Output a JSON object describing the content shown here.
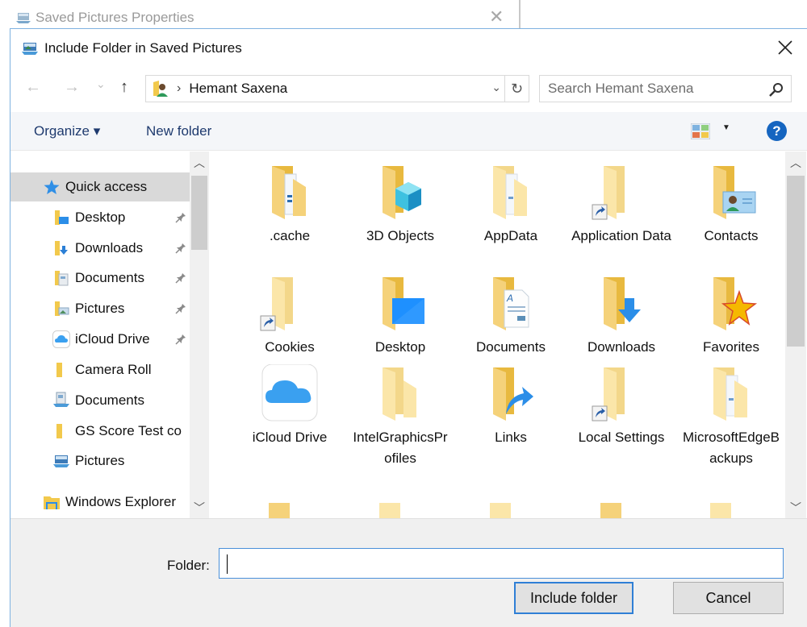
{
  "background_window": {
    "title": "Saved Pictures Properties",
    "icon": "library-pictures-icon",
    "close_glyph": "✕"
  },
  "dialog": {
    "title": "Include Folder in Saved Pictures",
    "icon": "library-pictures-icon",
    "close_glyph": "close-icon"
  },
  "navigation": {
    "back": "←",
    "forward": "→",
    "recent_dropdown": "⌄",
    "up": "↑",
    "address_icon": "user-folder-icon",
    "breadcrumb_separator": "›",
    "breadcrumb": "Hemant Saxena",
    "address_dropdown": "⌄",
    "refresh": "↻",
    "search_placeholder": "Search Hemant Saxena"
  },
  "toolbar": {
    "organize": "Organize ▾",
    "new_folder": "New folder",
    "view_icon": "change-view-icon",
    "view_dropdown": "▼",
    "help": "?"
  },
  "sidebar": {
    "items": [
      {
        "label": "Quick access",
        "icon": "star",
        "pinned": false,
        "selected": true,
        "level": 0
      },
      {
        "label": "Desktop",
        "icon": "desktop-folder",
        "pinned": true,
        "selected": false,
        "level": 1
      },
      {
        "label": "Downloads",
        "icon": "downloads-folder",
        "pinned": true,
        "selected": false,
        "level": 1
      },
      {
        "label": "Documents",
        "icon": "documents-folder",
        "pinned": true,
        "selected": false,
        "level": 1
      },
      {
        "label": "Pictures",
        "icon": "pictures-folder",
        "pinned": true,
        "selected": false,
        "level": 1
      },
      {
        "label": "iCloud Drive",
        "icon": "icloud",
        "pinned": true,
        "selected": false,
        "level": 1
      },
      {
        "label": "Camera Roll",
        "icon": "folder",
        "pinned": false,
        "selected": false,
        "level": 1
      },
      {
        "label": "Documents",
        "icon": "documents-library",
        "pinned": false,
        "selected": false,
        "level": 1
      },
      {
        "label": "GS Score Test co",
        "icon": "folder",
        "pinned": false,
        "selected": false,
        "level": 1
      },
      {
        "label": "Pictures",
        "icon": "pictures-library",
        "pinned": false,
        "selected": false,
        "level": 1
      },
      {
        "label": "Windows Explorer",
        "icon": "explorer-folder",
        "pinned": false,
        "selected": false,
        "level": 0
      }
    ]
  },
  "files": [
    {
      "name": ".cache",
      "icon": "folder-files"
    },
    {
      "name": "3D Objects",
      "icon": "folder-3d"
    },
    {
      "name": "AppData",
      "icon": "folder-files-light"
    },
    {
      "name": "Application Data",
      "icon": "folder-shortcut"
    },
    {
      "name": "Contacts",
      "icon": "folder-contacts"
    },
    {
      "name": "Cookies",
      "icon": "folder-shortcut"
    },
    {
      "name": "Desktop",
      "icon": "folder-desktop"
    },
    {
      "name": "Documents",
      "icon": "folder-documents"
    },
    {
      "name": "Downloads",
      "icon": "folder-downloads"
    },
    {
      "name": "Favorites",
      "icon": "folder-favorites"
    },
    {
      "name": "iCloud Drive",
      "icon": "icloud-app"
    },
    {
      "name": "IntelGraphicsProfiles",
      "icon": "folder-light"
    },
    {
      "name": "Links",
      "icon": "folder-links"
    },
    {
      "name": "Local Settings",
      "icon": "folder-shortcut"
    },
    {
      "name": "MicrosoftEdgeBackups",
      "icon": "folder-files-light"
    }
  ],
  "footer": {
    "folder_label": "Folder:",
    "folder_value": "",
    "include_button": "Include folder",
    "cancel_button": "Cancel"
  },
  "colors": {
    "accent": "#2f7fd6",
    "help": "#1565c0",
    "folder": "#f5d27a",
    "folder_light": "#fbe6a9",
    "selection": "#d9d9d9"
  }
}
